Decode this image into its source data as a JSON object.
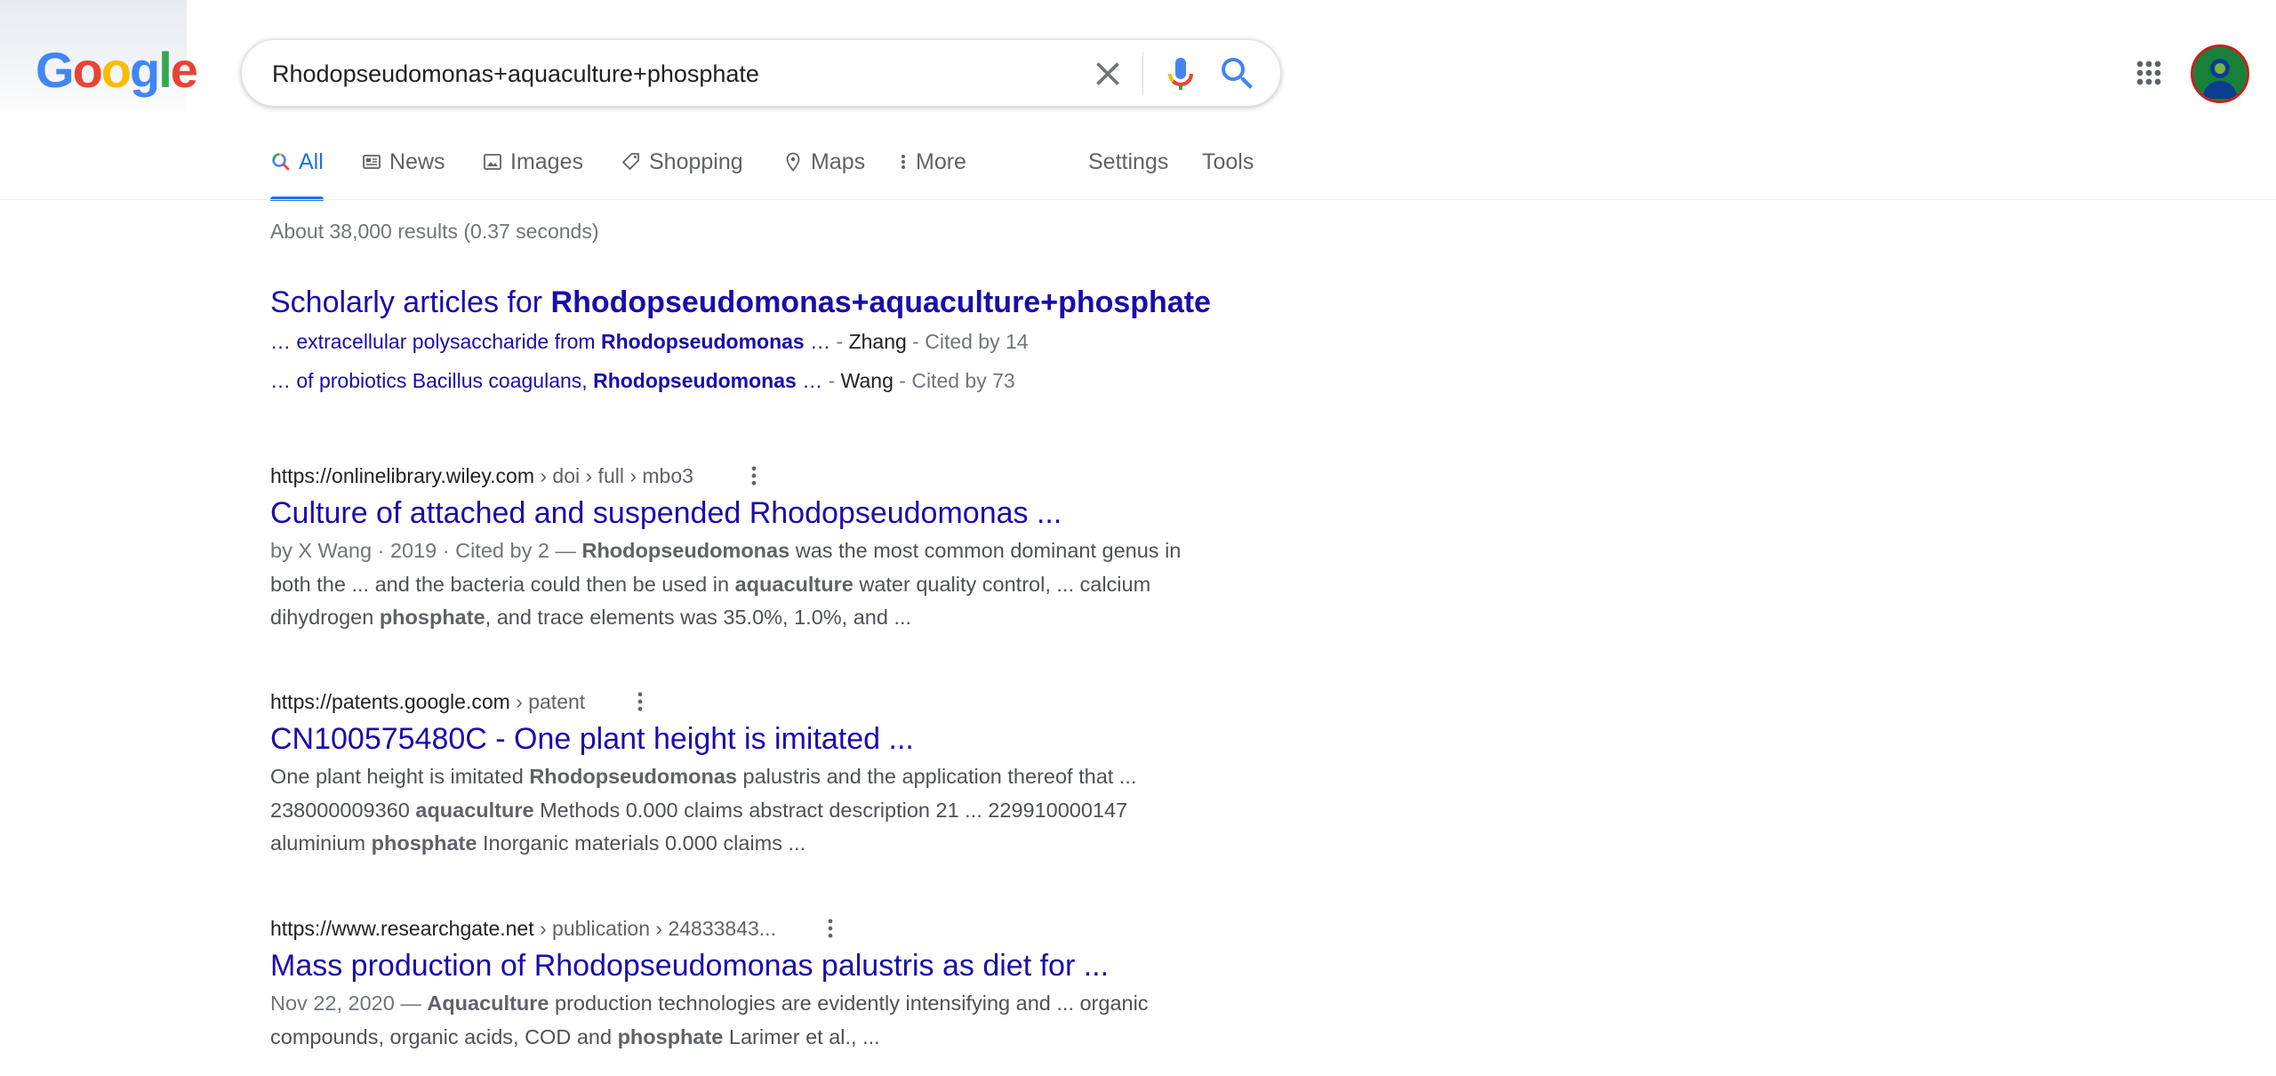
{
  "logo": {
    "letters": [
      "G",
      "o",
      "o",
      "g",
      "l",
      "e"
    ],
    "colors": [
      "#4285f4",
      "#ea4335",
      "#fbbc05",
      "#4285f4",
      "#34a853",
      "#ea4335"
    ]
  },
  "search": {
    "query": "Rhodopseudomonas+aquaculture+phosphate"
  },
  "icons": {
    "clear": "close-icon",
    "mic": "mic-icon",
    "search": "search-icon",
    "apps": "apps-icon",
    "more": "more-vert-icon"
  },
  "tabs": [
    {
      "label": "All",
      "active": true,
      "icon": "search-icon"
    },
    {
      "label": "News",
      "active": false,
      "icon": "news-icon"
    },
    {
      "label": "Images",
      "active": false,
      "icon": "image-icon"
    },
    {
      "label": "Shopping",
      "active": false,
      "icon": "tag-icon"
    },
    {
      "label": "Maps",
      "active": false,
      "icon": "map-pin-icon"
    },
    {
      "label": "More",
      "active": false,
      "icon": "more-vert-icon"
    }
  ],
  "tools": {
    "settings": "Settings",
    "tools": "Tools"
  },
  "stats": "About 38,000 results (0.37 seconds)",
  "scholarly": {
    "title_prefix": "Scholarly articles for ",
    "title_query": "Rhodopseudomonas+aquaculture+phosphate",
    "items": [
      {
        "pre": "… extracellular polysaccharide from ",
        "bold": "Rhodopseudomonas",
        "post": " …",
        "sep": " - ",
        "author": "Zhang",
        "cited": " - Cited by 14"
      },
      {
        "pre": "… of probiotics Bacillus coagulans, ",
        "bold": "Rhodopseudomonas",
        "post": " …",
        "sep": " - ",
        "author": "Wang",
        "cited": " - Cited by 73"
      }
    ]
  },
  "results": [
    {
      "domain": "https://onlinelibrary.wiley.com",
      "path": " › doi › full › mbo3",
      "title": "Culture of attached and suspended Rhodopseudomonas ...",
      "snippet": [
        {
          "t": "by X Wang · 2019 · Cited by 2 — ",
          "s": "meta"
        },
        {
          "t": "Rhodopseudomonas",
          "s": "b"
        },
        {
          "t": " was the most common dominant genus in both the ... and the bacteria could then be used in ",
          "s": ""
        },
        {
          "t": "aquaculture",
          "s": "b"
        },
        {
          "t": " water quality control, ... calcium dihydrogen ",
          "s": ""
        },
        {
          "t": "phosphate",
          "s": "b"
        },
        {
          "t": ", and trace elements was 35.0%, 1.0%, and ...",
          "s": ""
        }
      ]
    },
    {
      "domain": "https://patents.google.com",
      "path": " › patent",
      "title": "CN100575480C - One plant height is imitated ...",
      "snippet": [
        {
          "t": "One plant height is imitated ",
          "s": ""
        },
        {
          "t": "Rhodopseudomonas",
          "s": "b"
        },
        {
          "t": " palustris and the application thereof that ... 238000009360 ",
          "s": ""
        },
        {
          "t": "aquaculture",
          "s": "b"
        },
        {
          "t": " Methods 0.000 claims abstract description 21 ... 229910000147 aluminium ",
          "s": ""
        },
        {
          "t": "phosphate",
          "s": "b"
        },
        {
          "t": " Inorganic materials 0.000 claims ...",
          "s": ""
        }
      ]
    },
    {
      "domain": "https://www.researchgate.net",
      "path": " › publication › 24833843...",
      "title": "Mass production of Rhodopseudomonas palustris as diet for ...",
      "snippet": [
        {
          "t": "Nov 22, 2020 — ",
          "s": "meta"
        },
        {
          "t": "Aquaculture",
          "s": "b"
        },
        {
          "t": " production technologies are evidently intensifying and ... organic compounds, organic acids, COD and ",
          "s": ""
        },
        {
          "t": "phosphate",
          "s": "b"
        },
        {
          "t": " Larimer et al., ...",
          "s": ""
        }
      ]
    }
  ]
}
